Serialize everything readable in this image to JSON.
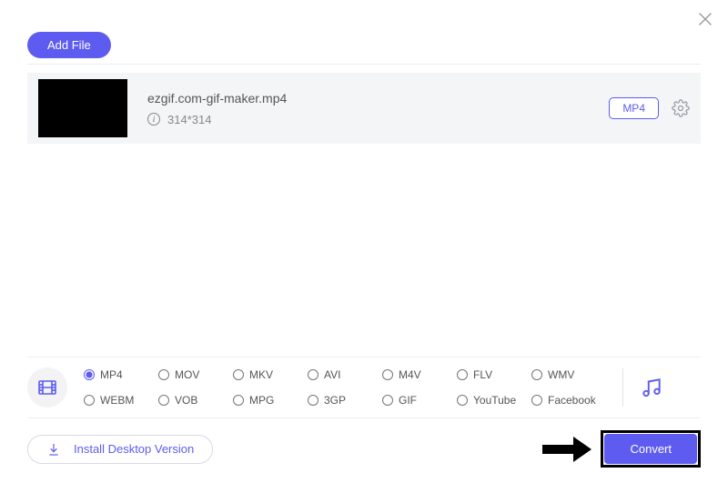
{
  "header": {
    "add_file_label": "Add File"
  },
  "file": {
    "name": "ezgif.com-gif-maker.mp4",
    "resolution": "314*314",
    "format_chip": "MP4"
  },
  "formats": {
    "selected": "MP4",
    "items": [
      "MP4",
      "MOV",
      "MKV",
      "AVI",
      "M4V",
      "FLV",
      "WMV",
      "WEBM",
      "VOB",
      "MPG",
      "3GP",
      "GIF",
      "YouTube",
      "Facebook"
    ]
  },
  "footer": {
    "install_label": "Install Desktop Version",
    "convert_label": "Convert"
  }
}
